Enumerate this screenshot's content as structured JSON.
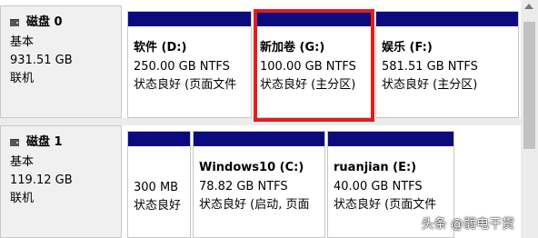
{
  "disk0": {
    "name": "磁盘 0",
    "type": "基本",
    "size": "931.51 GB",
    "status": "联机",
    "partitions": [
      {
        "title": "软件 (D:)",
        "size_fs": "250.00 GB NTFS",
        "status": "状态良好 (页面文件"
      },
      {
        "title": "新加卷 (G:)",
        "size_fs": "100.00 GB NTFS",
        "status": "状态良好 (主分区)"
      },
      {
        "title": "娱乐 (F:)",
        "size_fs": "581.51 GB NTFS",
        "status": "状态良好 (主分区)"
      }
    ]
  },
  "disk1": {
    "name": "磁盘 1",
    "type": "基本",
    "size": "119.12 GB",
    "status": "联机",
    "partitions": [
      {
        "title": "",
        "size_fs": "300 MB",
        "status": "状态良好"
      },
      {
        "title": "Windows10 (C:)",
        "size_fs": "78.82 GB NTFS",
        "status": "状态良好 (启动, 页面"
      },
      {
        "title": "ruanjian (E:)",
        "size_fs": "40.00 GB NTFS",
        "status": "状态良好 (页面文件"
      }
    ]
  },
  "watermark": "头条 @弱电干货",
  "colors": {
    "partition_bar": "#0b0b7f",
    "highlight": "#e51c1c"
  }
}
